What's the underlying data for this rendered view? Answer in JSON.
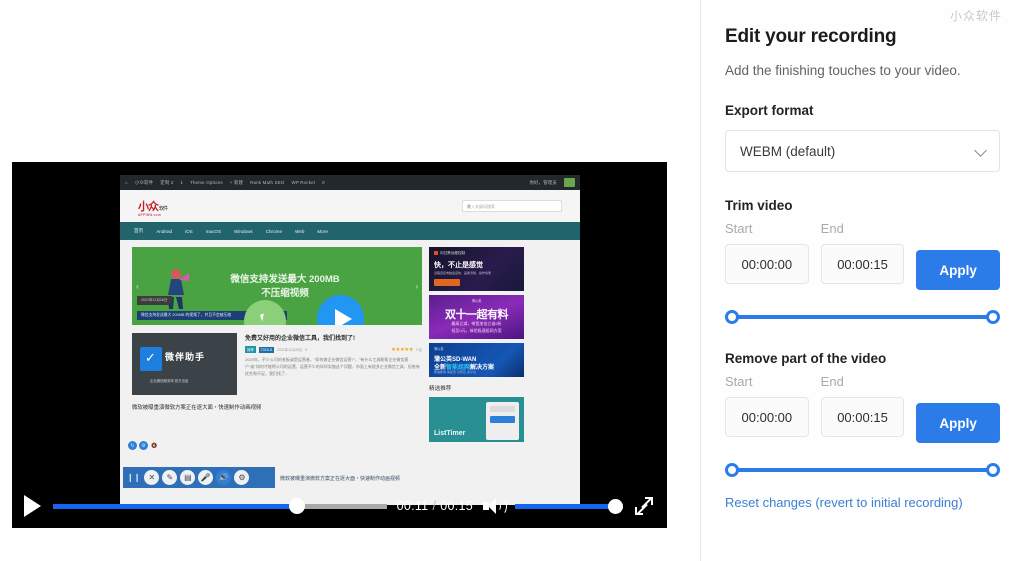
{
  "watermark": "小众软件",
  "panel": {
    "title": "Edit your recording",
    "subtitle": "Add the finishing touches to your video.",
    "export_label": "Export format",
    "export_value": "WEBM (default)",
    "chevron_icon": "chevron-down-icon",
    "trim": {
      "heading": "Trim video",
      "start_label": "Start",
      "end_label": "End",
      "start_value": "00:00:00",
      "end_value": "00:00:15",
      "apply_label": "Apply"
    },
    "remove": {
      "heading": "Remove part of the video",
      "start_label": "Start",
      "end_label": "End",
      "start_value": "00:00:00",
      "end_value": "00:00:15",
      "apply_label": "Apply"
    },
    "reset_label": "Reset changes (revert to initial recording)",
    "accent_color": "#2b7ce8",
    "link_color": "#3b7fd4"
  },
  "player": {
    "play_icon": "play-icon",
    "current_time": "00:11",
    "separator": "/",
    "duration": "00:15",
    "progress_percent": 73,
    "volume_percent": 100,
    "volume_icon": "volume-high-icon",
    "fullscreen_icon": "fullscreen-icon",
    "progress_color": "#1565ef"
  },
  "recording": {
    "admin_bar": {
      "items": [
        "⌂",
        "小众软件",
        "定制 2",
        "1",
        "Theme Options",
        "+ 新建",
        "Rank Math SEO",
        "WP Rocket",
        "0"
      ],
      "right_items": [
        "你好，管理员"
      ],
      "avatar_icon": "gravatar-avatar-icon"
    },
    "site": {
      "logo_main": "小众",
      "logo_sub": "软件",
      "logo_domain": "APPINN.com",
      "search_placeholder": "输入关键词搜索",
      "search_icon": "search-icon"
    },
    "nav": [
      "首页",
      "Android",
      "iOS",
      "macOS",
      "Windows",
      "Chrome",
      "Web",
      "More"
    ],
    "banner": {
      "line1": "微信支持发送最大 200MB",
      "line2": "不压缩视频",
      "date_tag": "2021年11月26日",
      "caption_tag": "微信支持发送最大 200MB 的视频了，并且不会被压缩",
      "prev_icon": "chevron-left-icon",
      "next_icon": "chevron-right-icon",
      "play_overlay_icon": "play-circle-icon",
      "cursor_icon": "cursor-click-icon",
      "bg_color": "#4aa342"
    },
    "article": {
      "thumb_title": "微伴助手",
      "thumb_sub": "企业微信服务商 官方出品",
      "title": "免费又好用的企业微信工具，我们找到了!",
      "badge1": "效率",
      "badge2": "TOOLS",
      "meta_date": "2021年11月26日",
      "comment_count": "9",
      "rating_value": "5 星",
      "stars": "★★★★★",
      "desc": "2020年，不少公司的老板或是运营者，\"如何做企业微信运营?\"、\"有什么工具能帮企业微信客户\"或\"如何才能将公司的运营、运营不少的伙伴实施这个问题，市面上有很多企业微信工具，但各有优劣和不足，我们找了..."
    },
    "article2_title": "微软被曝重演微软方案正在逐大面・快速制作动画视频",
    "ads": [
      {
        "tag": "向日葵远程控制",
        "headline": "快，不止是感觉",
        "sub": "远程连接电脑速度快，画质清晰，操作简便",
        "button": "立即体验"
      },
      {
        "tag": "蒲公英",
        "headline": "双十一超有料",
        "line1": "最高立减，带宽加倍立省5折",
        "line2": "低至0元，体验极速组网方案"
      },
      {
        "tag": "蒲公英",
        "line1": "蒲公英SD-WAN",
        "line2_a": "全新",
        "line2_b": "智能组网",
        "line2_c": "解决方案",
        "line3": "即插即用·免配置·高稳定·多平台"
      }
    ],
    "featured_title": "精选推荐",
    "featured_card": "ListTimer",
    "recorder_toolbar": {
      "icons": [
        "pause-icon",
        "stop-icon",
        "pen-icon",
        "camera-icon",
        "microphone-icon",
        "speaker-icon",
        "settings-icon"
      ]
    },
    "mini_toolbar": {
      "icons": [
        "refresh-icon",
        "settings-icon",
        "mute-icon"
      ]
    }
  }
}
